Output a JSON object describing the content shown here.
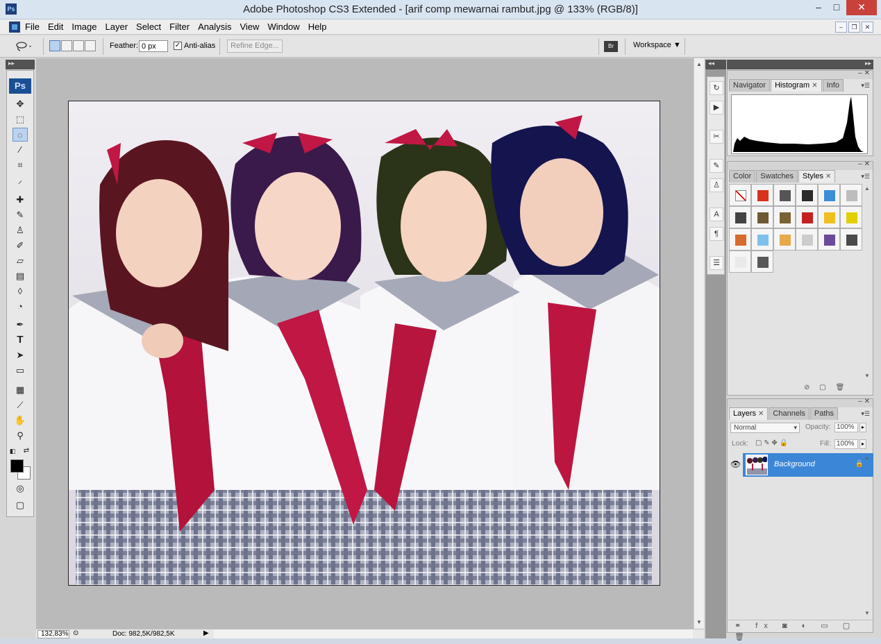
{
  "window": {
    "app_icon": "Ps",
    "title": "Adobe Photoshop CS3 Extended - [arif comp mewarnai rambut.jpg @ 133% (RGB/8)]",
    "controls": {
      "minimize": "–",
      "maximize": "□",
      "close": "✕"
    }
  },
  "menu": {
    "items": [
      "File",
      "Edit",
      "Image",
      "Layer",
      "Select",
      "Filter",
      "Analysis",
      "View",
      "Window",
      "Help"
    ],
    "doc_controls": {
      "minimize": "–",
      "restore": "❐",
      "close": "✕"
    }
  },
  "options": {
    "feather_label": "Feather:",
    "feather_value": "0 px",
    "anti_alias_label": "Anti-alias",
    "anti_alias_checked": "✓",
    "refine_edge_label": "Refine Edge...",
    "bridge_label": "Br",
    "workspace_label": "Workspace ▼"
  },
  "toolbox": {
    "logo": "Ps",
    "collapse": "▸▸"
  },
  "canvas": {
    "document_name": "arif comp mewarnai rambut.jpg",
    "zoom": "133%"
  },
  "status": {
    "zoom": "132,83%",
    "doc_info": "Doc: 982,5K/982,5K"
  },
  "panels": {
    "top_arrows_left": "◂◂",
    "top_arrows_right": "▸▸",
    "group1": {
      "tabs": [
        "Navigator",
        "Histogram",
        "Info"
      ],
      "active_tab": "Histogram"
    },
    "group2": {
      "tabs": [
        "Color",
        "Swatches",
        "Styles"
      ],
      "active_tab": "Styles",
      "style_colors": [
        "#ffffff",
        "#d8321c",
        "#555555",
        "#2a2a2a",
        "#3b8fd8",
        "#bdbdbd",
        "#444444",
        "#6e5a32",
        "#7a6234",
        "#c42020",
        "#f0c020",
        "#e0d000",
        "#d86a2c",
        "#7dc1ea",
        "#e7a94c",
        "#cccccc",
        "#6a4a9a",
        "#4a4a4a",
        "#eaeaea",
        "#585858"
      ]
    },
    "group3": {
      "tabs": [
        "Layers",
        "Channels",
        "Paths"
      ],
      "active_tab": "Layers",
      "blend_mode": "Normal",
      "opacity_label": "Opacity:",
      "opacity_value": "100%",
      "lock_label": "Lock:",
      "fill_label": "Fill:",
      "fill_value": "100%",
      "layer_name": "Background"
    }
  },
  "colors": {
    "fg": "#000000",
    "bg": "#ffffff",
    "selection": "#3b86d6"
  }
}
